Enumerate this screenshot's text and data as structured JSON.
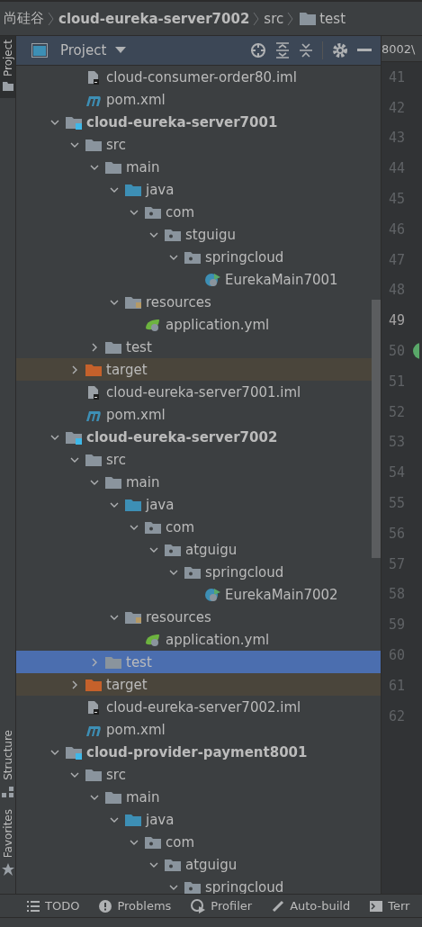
{
  "breadcrumb": [
    {
      "label": "尚硅谷",
      "kind": "text"
    },
    {
      "label": "cloud-eureka-server7002",
      "kind": "module"
    },
    {
      "label": "src",
      "kind": "text"
    },
    {
      "label": "test",
      "kind": "folder"
    }
  ],
  "side_tabs_top": [
    {
      "label": "Project",
      "selected": true
    }
  ],
  "side_tabs_bottom": [
    {
      "label": "Structure",
      "selected": false
    },
    {
      "label": "Favorites",
      "selected": false
    }
  ],
  "project_panel": {
    "title": "Project"
  },
  "editor": {
    "tab_text": "8002\\",
    "lines": [
      {
        "number": "41",
        "current": false,
        "marker": false
      },
      {
        "number": "42",
        "current": false,
        "marker": false
      },
      {
        "number": "43",
        "current": false,
        "marker": false
      },
      {
        "number": "44",
        "current": false,
        "marker": false
      },
      {
        "number": "45",
        "current": false,
        "marker": false
      },
      {
        "number": "46",
        "current": false,
        "marker": false
      },
      {
        "number": "47",
        "current": false,
        "marker": false
      },
      {
        "number": "48",
        "current": false,
        "marker": false
      },
      {
        "number": "49",
        "current": true,
        "marker": false
      },
      {
        "number": "50",
        "current": false,
        "marker": true
      },
      {
        "number": "51",
        "current": false,
        "marker": false
      },
      {
        "number": "52",
        "current": false,
        "marker": false
      },
      {
        "number": "53",
        "current": false,
        "marker": false
      },
      {
        "number": "54",
        "current": false,
        "marker": false
      },
      {
        "number": "55",
        "current": false,
        "marker": false
      },
      {
        "number": "56",
        "current": false,
        "marker": false
      },
      {
        "number": "57",
        "current": false,
        "marker": false
      },
      {
        "number": "58",
        "current": false,
        "marker": false
      },
      {
        "number": "59",
        "current": false,
        "marker": false
      },
      {
        "number": "60",
        "current": false,
        "marker": false
      },
      {
        "number": "61",
        "current": false,
        "marker": false
      },
      {
        "number": "62",
        "current": false,
        "marker": false
      }
    ]
  },
  "tree": {
    "scrolled_parent_items": [
      {
        "label": "cloud-consumer-order80.iml",
        "kind": "iml",
        "selected": false
      },
      {
        "label": "pom.xml",
        "kind": "maven",
        "selected": false
      }
    ],
    "items": [
      {
        "label": "cloud-eureka-server7001",
        "kind": "module",
        "expanded": true,
        "selected": false,
        "children": [
          {
            "label": "src",
            "kind": "folder",
            "expanded": true,
            "selected": false,
            "children": [
              {
                "label": "main",
                "kind": "folder",
                "expanded": true,
                "selected": false,
                "children": [
                  {
                    "label": "java",
                    "kind": "source",
                    "expanded": true,
                    "selected": false,
                    "children": [
                      {
                        "label": "com",
                        "kind": "package",
                        "expanded": true,
                        "selected": false,
                        "children": [
                          {
                            "label": "stguigu",
                            "kind": "package",
                            "expanded": true,
                            "selected": false,
                            "children": [
                              {
                                "label": "springcloud",
                                "kind": "package",
                                "expanded": true,
                                "selected": false,
                                "children": [
                                  {
                                    "label": "EurekaMain7001",
                                    "kind": "class",
                                    "selected": false
                                  }
                                ]
                              }
                            ]
                          }
                        ]
                      }
                    ]
                  },
                  {
                    "label": "resources",
                    "kind": "resources",
                    "expanded": true,
                    "selected": false,
                    "children": [
                      {
                        "label": "application.yml",
                        "kind": "spring",
                        "selected": false
                      }
                    ]
                  }
                ]
              },
              {
                "label": "test",
                "kind": "folder",
                "expanded": false,
                "selected": false
              }
            ]
          },
          {
            "label": "target",
            "kind": "excluded",
            "expanded": false,
            "selected": false
          },
          {
            "label": "cloud-eureka-server7001.iml",
            "kind": "iml",
            "selected": false
          },
          {
            "label": "pom.xml",
            "kind": "maven",
            "selected": false
          }
        ]
      },
      {
        "label": "cloud-eureka-server7002",
        "kind": "module",
        "expanded": true,
        "selected": false,
        "children": [
          {
            "label": "src",
            "kind": "folder",
            "expanded": true,
            "selected": false,
            "children": [
              {
                "label": "main",
                "kind": "folder",
                "expanded": true,
                "selected": false,
                "children": [
                  {
                    "label": "java",
                    "kind": "source",
                    "expanded": true,
                    "selected": false,
                    "children": [
                      {
                        "label": "com",
                        "kind": "package",
                        "expanded": true,
                        "selected": false,
                        "children": [
                          {
                            "label": "atguigu",
                            "kind": "package",
                            "expanded": true,
                            "selected": false,
                            "children": [
                              {
                                "label": "springcloud",
                                "kind": "package",
                                "expanded": true,
                                "selected": false,
                                "children": [
                                  {
                                    "label": "EurekaMain7002",
                                    "kind": "class",
                                    "selected": false
                                  }
                                ]
                              }
                            ]
                          }
                        ]
                      }
                    ]
                  },
                  {
                    "label": "resources",
                    "kind": "resources",
                    "expanded": true,
                    "selected": false,
                    "children": [
                      {
                        "label": "application.yml",
                        "kind": "spring",
                        "selected": false
                      }
                    ]
                  }
                ]
              },
              {
                "label": "test",
                "kind": "folder",
                "expanded": false,
                "selected": true
              }
            ]
          },
          {
            "label": "target",
            "kind": "excluded",
            "expanded": false,
            "selected": false
          },
          {
            "label": "cloud-eureka-server7002.iml",
            "kind": "iml",
            "selected": false
          },
          {
            "label": "pom.xml",
            "kind": "maven",
            "selected": false
          }
        ]
      },
      {
        "label": "cloud-provider-payment8001",
        "kind": "module",
        "expanded": true,
        "selected": false,
        "children": [
          {
            "label": "src",
            "kind": "folder",
            "expanded": true,
            "selected": false,
            "children": [
              {
                "label": "main",
                "kind": "folder",
                "expanded": true,
                "selected": false,
                "children": [
                  {
                    "label": "java",
                    "kind": "source",
                    "expanded": true,
                    "selected": false,
                    "children": [
                      {
                        "label": "com",
                        "kind": "package",
                        "expanded": true,
                        "selected": false,
                        "children": [
                          {
                            "label": "atguigu",
                            "kind": "package",
                            "expanded": true,
                            "selected": false,
                            "children": [
                              {
                                "label": "springcloud",
                                "kind": "package",
                                "expanded": true,
                                "selected": false
                              }
                            ]
                          }
                        ]
                      }
                    ]
                  }
                ]
              }
            ]
          }
        ]
      }
    ]
  },
  "bottom_tools": [
    {
      "label": "TODO",
      "kind": "todo"
    },
    {
      "label": "Problems",
      "kind": "problems"
    },
    {
      "label": "Profiler",
      "kind": "profiler"
    },
    {
      "label": "Auto-build",
      "kind": "build"
    },
    {
      "label": "Terr",
      "kind": "terminal"
    }
  ]
}
